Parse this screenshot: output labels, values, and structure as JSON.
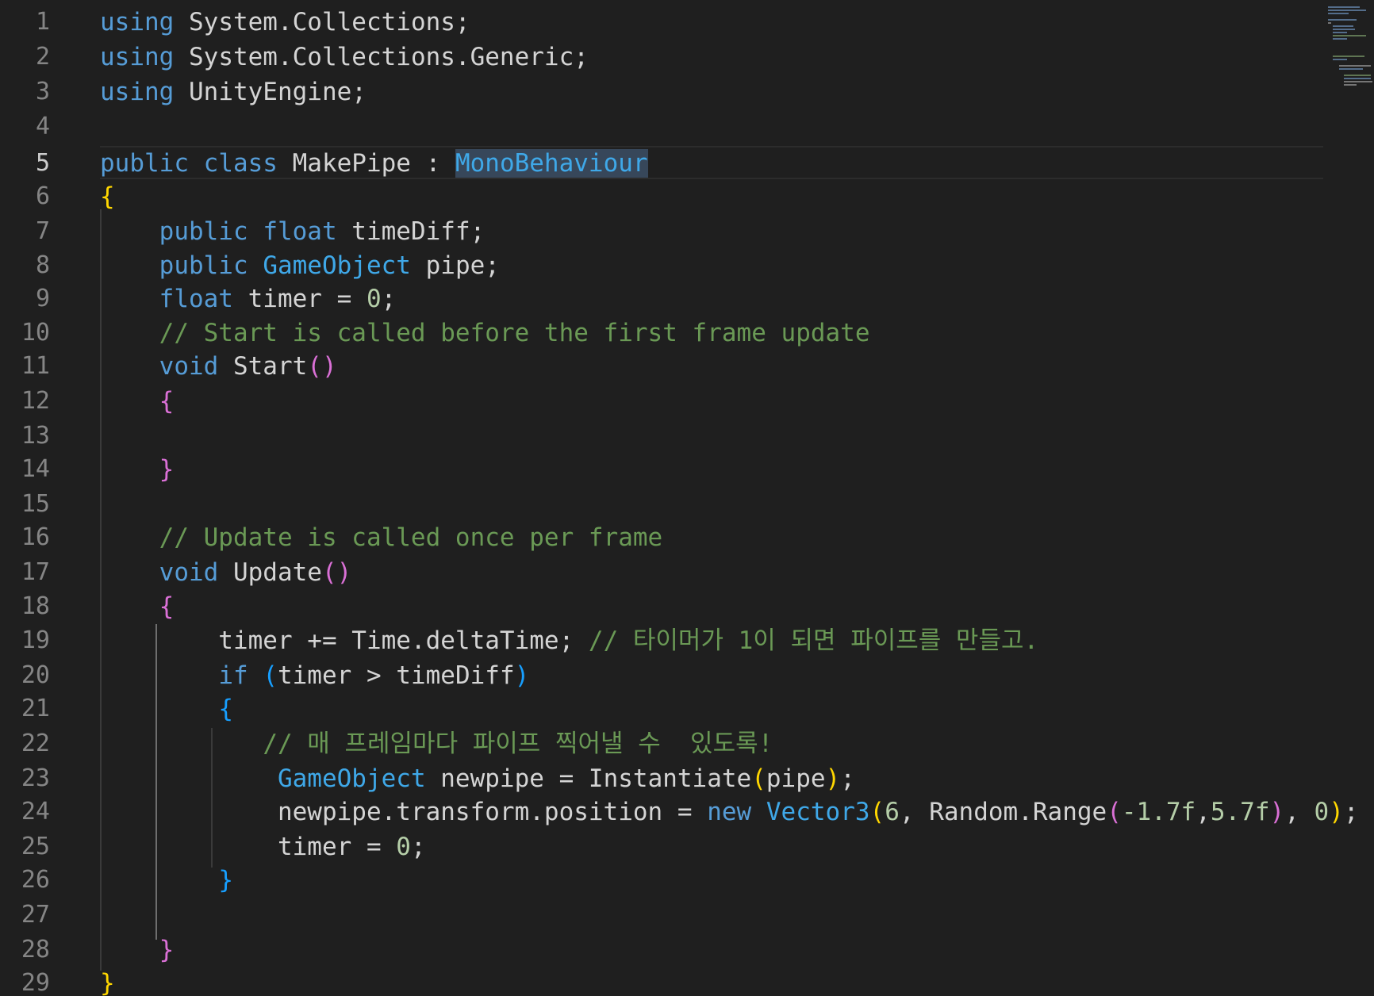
{
  "editor": {
    "language": "csharp",
    "active_line": "5",
    "lines": [
      {
        "n": "1",
        "tokens": [
          [
            "kw",
            "using"
          ],
          [
            "plain",
            " System.Collections;"
          ]
        ]
      },
      {
        "n": "2",
        "tokens": [
          [
            "kw",
            "using"
          ],
          [
            "plain",
            " System.Collections.Generic;"
          ]
        ]
      },
      {
        "n": "3",
        "tokens": [
          [
            "kw",
            "using"
          ],
          [
            "plain",
            " UnityEngine;"
          ]
        ]
      },
      {
        "n": "4",
        "tokens": []
      },
      {
        "n": "5",
        "tokens": [
          [
            "kw",
            "public"
          ],
          [
            "plain",
            " "
          ],
          [
            "kw",
            "class"
          ],
          [
            "plain",
            " MakePipe : "
          ],
          [
            "ty2 hl",
            "MonoBehaviour"
          ]
        ]
      },
      {
        "n": "6",
        "tokens": [
          [
            "br1",
            "{"
          ]
        ]
      },
      {
        "n": "7",
        "tokens": [
          [
            "plain",
            "    "
          ],
          [
            "kw",
            "public"
          ],
          [
            "plain",
            " "
          ],
          [
            "kw",
            "float"
          ],
          [
            "plain",
            " timeDiff;"
          ]
        ]
      },
      {
        "n": "8",
        "tokens": [
          [
            "plain",
            "    "
          ],
          [
            "kw",
            "public"
          ],
          [
            "plain",
            " "
          ],
          [
            "ty2",
            "GameObject"
          ],
          [
            "plain",
            " pipe;"
          ]
        ]
      },
      {
        "n": "9",
        "tokens": [
          [
            "plain",
            "    "
          ],
          [
            "kw",
            "float"
          ],
          [
            "plain",
            " timer = "
          ],
          [
            "num",
            "0"
          ],
          [
            "plain",
            ";"
          ]
        ]
      },
      {
        "n": "10",
        "tokens": [
          [
            "plain",
            "    "
          ],
          [
            "cm",
            "// Start is called before the first frame update"
          ]
        ]
      },
      {
        "n": "11",
        "tokens": [
          [
            "plain",
            "    "
          ],
          [
            "kw",
            "void"
          ],
          [
            "plain",
            " Start"
          ],
          [
            "br2",
            "()"
          ]
        ]
      },
      {
        "n": "12",
        "tokens": [
          [
            "plain",
            "    "
          ],
          [
            "br2",
            "{"
          ]
        ]
      },
      {
        "n": "13",
        "tokens": []
      },
      {
        "n": "14",
        "tokens": [
          [
            "plain",
            "    "
          ],
          [
            "br2",
            "}"
          ]
        ]
      },
      {
        "n": "15",
        "tokens": []
      },
      {
        "n": "16",
        "tokens": [
          [
            "plain",
            "    "
          ],
          [
            "cm",
            "// Update is called once per frame"
          ]
        ]
      },
      {
        "n": "17",
        "tokens": [
          [
            "plain",
            "    "
          ],
          [
            "kw",
            "void"
          ],
          [
            "plain",
            " Update"
          ],
          [
            "br2",
            "()"
          ]
        ]
      },
      {
        "n": "18",
        "tokens": [
          [
            "plain",
            "    "
          ],
          [
            "br2",
            "{"
          ]
        ]
      },
      {
        "n": "19",
        "tokens": [
          [
            "plain",
            "        timer += Time.deltaTime; "
          ],
          [
            "cm",
            "// 타이머가 1이 되면 파이프를 만들고."
          ]
        ]
      },
      {
        "n": "20",
        "tokens": [
          [
            "plain",
            "        "
          ],
          [
            "ctrl",
            "if"
          ],
          [
            "plain",
            " "
          ],
          [
            "br3",
            "("
          ],
          [
            "plain",
            "timer > timeDiff"
          ],
          [
            "br3",
            ")"
          ]
        ]
      },
      {
        "n": "21",
        "tokens": [
          [
            "plain",
            "        "
          ],
          [
            "br3",
            "{"
          ]
        ]
      },
      {
        "n": "22",
        "tokens": [
          [
            "plain",
            "           "
          ],
          [
            "cm",
            "// 매 프레임마다 파이프 찍어낼 수  있도록!"
          ]
        ]
      },
      {
        "n": "23",
        "tokens": [
          [
            "plain",
            "            "
          ],
          [
            "ty2",
            "GameObject"
          ],
          [
            "plain",
            " newpipe = Instantiate"
          ],
          [
            "br1",
            "("
          ],
          [
            "plain",
            "pipe"
          ],
          [
            "br1",
            ")"
          ],
          [
            "plain",
            ";"
          ]
        ]
      },
      {
        "n": "24",
        "tokens": [
          [
            "plain",
            "            newpipe.transform.position = "
          ],
          [
            "kw",
            "new"
          ],
          [
            "plain",
            " "
          ],
          [
            "ty2",
            "Vector3"
          ],
          [
            "br1",
            "("
          ],
          [
            "num",
            "6"
          ],
          [
            "plain",
            ", Random.Range"
          ],
          [
            "br2",
            "("
          ],
          [
            "num",
            "-1.7f"
          ],
          [
            "plain",
            ","
          ],
          [
            "num",
            "5.7f"
          ],
          [
            "br2",
            ")"
          ],
          [
            "plain",
            ", "
          ],
          [
            "num",
            "0"
          ],
          [
            "br1",
            ")"
          ],
          [
            "plain",
            ";"
          ]
        ]
      },
      {
        "n": "25",
        "tokens": [
          [
            "plain",
            "            timer = "
          ],
          [
            "num",
            "0"
          ],
          [
            "plain",
            ";"
          ]
        ]
      },
      {
        "n": "26",
        "tokens": [
          [
            "plain",
            "        "
          ],
          [
            "br3",
            "}"
          ]
        ]
      },
      {
        "n": "27",
        "tokens": []
      },
      {
        "n": "28",
        "tokens": [
          [
            "plain",
            "    "
          ],
          [
            "br2",
            "}"
          ]
        ]
      },
      {
        "n": "29",
        "tokens": [
          [
            "br1",
            "}"
          ]
        ]
      }
    ]
  },
  "colors": {
    "background": "#1f1f1f",
    "keyword": "#569cd6",
    "type": "#3fa8e8",
    "comment": "#6a9955",
    "number": "#b5cea8",
    "bracket_level1": "#ffd700",
    "bracket_level2": "#da70d6",
    "bracket_level3": "#179fff",
    "line_number": "#858585"
  }
}
